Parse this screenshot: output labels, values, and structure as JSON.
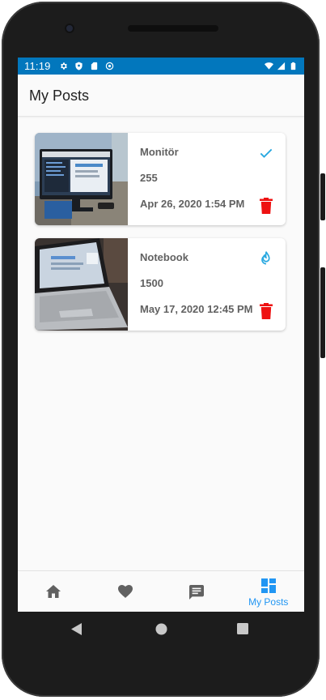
{
  "status_bar": {
    "time": "11:19",
    "left_icons": [
      "gear-icon",
      "shield-icon",
      "sd-card-icon",
      "sync-icon"
    ],
    "right_icons": [
      "wifi-icon",
      "signal-icon",
      "battery-icon"
    ],
    "color": "#0277bd"
  },
  "header": {
    "title": "My Posts"
  },
  "posts": [
    {
      "title": "Monitör",
      "price": "255",
      "date": "Apr 26, 2020 1:54 PM",
      "status_icon": "check-icon",
      "status_color": "#29a8e0"
    },
    {
      "title": "Notebook",
      "price": "1500",
      "date": "May 17, 2020 12:45 PM",
      "status_icon": "fire-icon",
      "status_color": "#29a8e0"
    }
  ],
  "bottom_nav": {
    "items": [
      {
        "icon": "home-icon",
        "label": "",
        "active": false
      },
      {
        "icon": "heart-icon",
        "label": "",
        "active": false
      },
      {
        "icon": "chat-icon",
        "label": "",
        "active": false
      },
      {
        "icon": "dashboard-icon",
        "label": "My Posts",
        "active": true
      }
    ],
    "active_color": "#2196f3",
    "inactive_color": "#616161"
  },
  "colors": {
    "delete": "#ee1111",
    "text": "#616161"
  }
}
